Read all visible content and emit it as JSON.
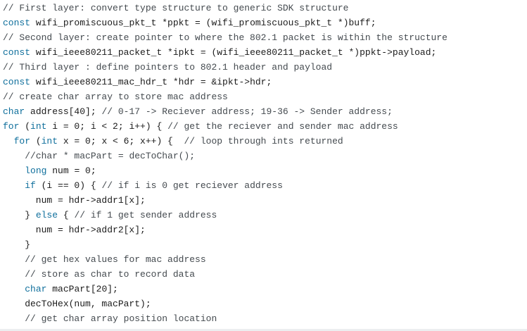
{
  "colors": {
    "background": "#ffffff",
    "comment": "#444a4f",
    "keyword": "#0f6f9c",
    "plain": "#1b1b1b"
  },
  "lines": [
    [
      {
        "t": "comment",
        "s": "// First layer: convert type structure to generic SDK structure"
      }
    ],
    [
      {
        "t": "keyword",
        "s": "const"
      },
      {
        "t": "plain",
        "s": " wifi_promiscuous_pkt_t *ppkt = (wifi_promiscuous_pkt_t *)buff;"
      }
    ],
    [
      {
        "t": "comment",
        "s": "// Second layer: create pointer to where the 802.1 packet is within the structure"
      }
    ],
    [
      {
        "t": "keyword",
        "s": "const"
      },
      {
        "t": "plain",
        "s": " wifi_ieee80211_packet_t *ipkt = (wifi_ieee80211_packet_t *)ppkt->payload;"
      }
    ],
    [
      {
        "t": "comment",
        "s": "// Third layer : define pointers to 802.1 header and payload"
      }
    ],
    [
      {
        "t": "keyword",
        "s": "const"
      },
      {
        "t": "plain",
        "s": " wifi_ieee80211_mac_hdr_t *hdr = &ipkt->hdr;"
      }
    ],
    [
      {
        "t": "comment",
        "s": "// create char array to store mac address"
      }
    ],
    [
      {
        "t": "keyword",
        "s": "char"
      },
      {
        "t": "plain",
        "s": " address[40]; "
      },
      {
        "t": "comment",
        "s": "// 0-17 -> Reciever address; 19-36 -> Sender address;"
      }
    ],
    [
      {
        "t": "keyword",
        "s": "for"
      },
      {
        "t": "plain",
        "s": " ("
      },
      {
        "t": "keyword",
        "s": "int"
      },
      {
        "t": "plain",
        "s": " i = 0; i < 2; i++) { "
      },
      {
        "t": "comment",
        "s": "// get the reciever and sender mac address"
      }
    ],
    [
      {
        "t": "plain",
        "s": "  "
      },
      {
        "t": "keyword",
        "s": "for"
      },
      {
        "t": "plain",
        "s": " ("
      },
      {
        "t": "keyword",
        "s": "int"
      },
      {
        "t": "plain",
        "s": " x = 0; x < 6; x++) {  "
      },
      {
        "t": "comment",
        "s": "// loop through ints returned"
      }
    ],
    [
      {
        "t": "plain",
        "s": "    "
      },
      {
        "t": "comment",
        "s": "//char * macPart = decToChar();"
      }
    ],
    [
      {
        "t": "plain",
        "s": "    "
      },
      {
        "t": "keyword",
        "s": "long"
      },
      {
        "t": "plain",
        "s": " num = 0;"
      }
    ],
    [
      {
        "t": "plain",
        "s": "    "
      },
      {
        "t": "keyword",
        "s": "if"
      },
      {
        "t": "plain",
        "s": " (i == 0) { "
      },
      {
        "t": "comment",
        "s": "// if i is 0 get reciever address"
      }
    ],
    [
      {
        "t": "plain",
        "s": "      num = hdr->addr1[x];"
      }
    ],
    [
      {
        "t": "plain",
        "s": "    } "
      },
      {
        "t": "keyword",
        "s": "else"
      },
      {
        "t": "plain",
        "s": " { "
      },
      {
        "t": "comment",
        "s": "// if 1 get sender address"
      }
    ],
    [
      {
        "t": "plain",
        "s": "      num = hdr->addr2[x];"
      }
    ],
    [
      {
        "t": "plain",
        "s": "    }"
      }
    ],
    [
      {
        "t": "plain",
        "s": "    "
      },
      {
        "t": "comment",
        "s": "// get hex values for mac address"
      }
    ],
    [
      {
        "t": "plain",
        "s": "    "
      },
      {
        "t": "comment",
        "s": "// store as char to record data"
      }
    ],
    [
      {
        "t": "plain",
        "s": "    "
      },
      {
        "t": "keyword",
        "s": "char"
      },
      {
        "t": "plain",
        "s": " macPart[20];"
      }
    ],
    [
      {
        "t": "plain",
        "s": "    decToHex(num, macPart);"
      }
    ],
    [
      {
        "t": "plain",
        "s": "    "
      },
      {
        "t": "comment",
        "s": "// get char array position location"
      }
    ]
  ]
}
